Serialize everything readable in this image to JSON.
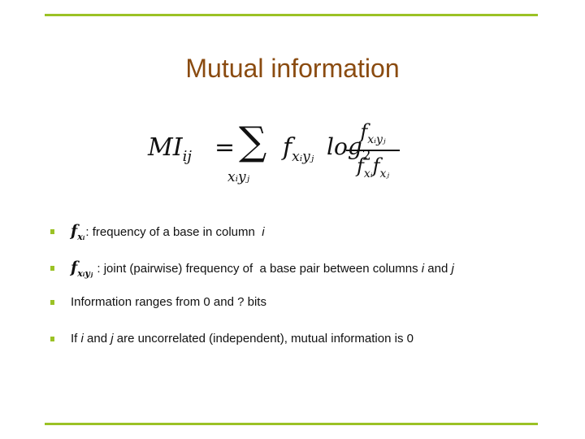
{
  "slide": {
    "title": "Mutual information",
    "accent_color": "#9bc225",
    "title_color": "#8a4b10",
    "formula": {
      "lhs": "MI",
      "lhs_sub": "ij",
      "equals": "=",
      "sum_symbol": "∑",
      "sum_sub": "xᵢyⱼ",
      "term": "f",
      "term_sub": "xᵢyⱼ",
      "log": "log",
      "log_base": "2",
      "numerator": "f",
      "numerator_sub": "xᵢyⱼ",
      "denominator_1": "f",
      "denominator_1_sub": "xᵢ",
      "denominator_2": "f",
      "denominator_2_sub": "xⱼ"
    },
    "bullets": [
      {
        "symbol": "f",
        "symbol_sub": "xᵢ",
        "text": ": frequency of a base in column ",
        "var": "i"
      },
      {
        "symbol": "f",
        "symbol_sub": "xᵢyⱼ",
        "text": " : joint (pairwise) frequency of  a base pair between columns ",
        "var": "i",
        "mid": " and ",
        "var2": "j"
      },
      {
        "text": "Information ranges from 0 and ? bits"
      },
      {
        "pre": "If ",
        "var": "i",
        "mid": " and ",
        "var2": "j",
        "text": " are uncorrelated (independent), mutual information is 0"
      }
    ]
  }
}
